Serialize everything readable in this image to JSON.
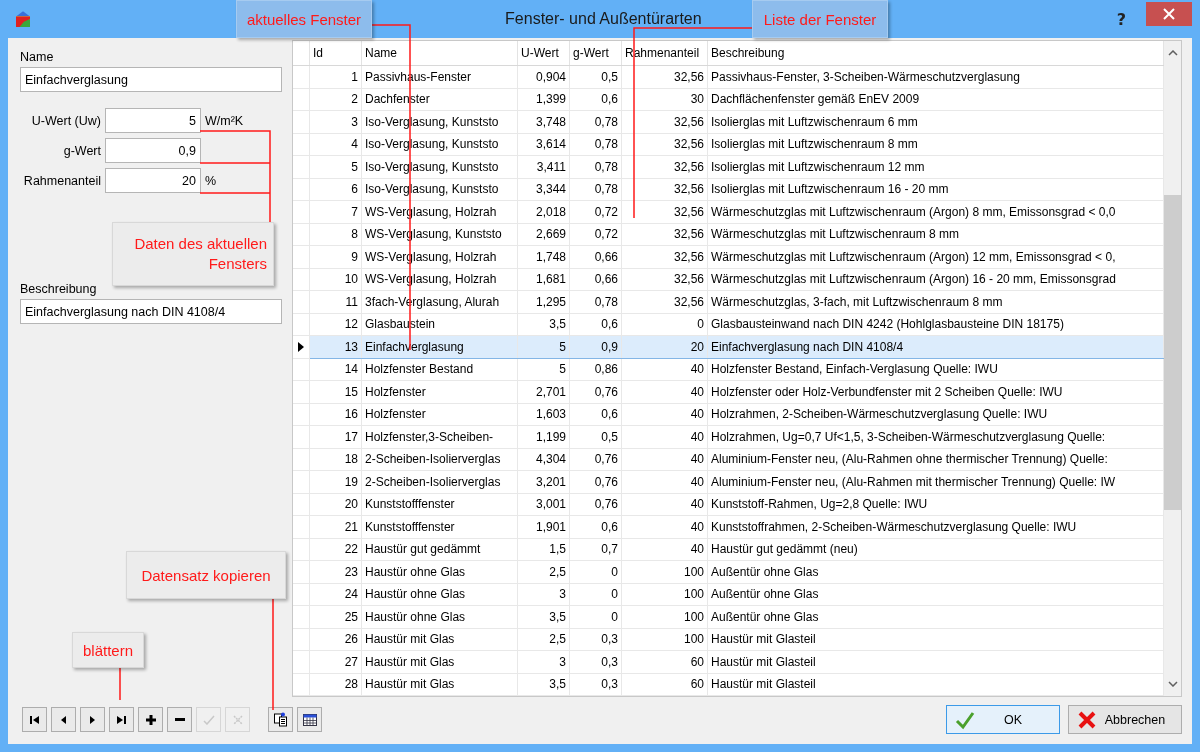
{
  "window": {
    "title": "Fenster- und Außentürarten",
    "help": "?"
  },
  "form": {
    "name_label": "Name",
    "name_value": "Einfachverglasung",
    "fields": [
      {
        "label": "U-Wert (Uw)",
        "value": "5",
        "unit": "W/m²K"
      },
      {
        "label": "g-Wert",
        "value": "0,9"
      },
      {
        "label": "Rahmenanteil",
        "value": "20",
        "unit": "%"
      }
    ],
    "description_label": "Beschreibung",
    "description_value": "Einfachverglasung nach DIN 4108/4"
  },
  "table": {
    "columns": [
      "Id",
      "Name",
      "U-Wert",
      "g-Wert",
      "Rahmenanteil",
      "Beschreibung"
    ],
    "rows": [
      {
        "cells": [
          "1",
          "Passivhaus-Fenster",
          "0,904",
          "0,5",
          "32,56",
          "Passivhaus-Fenster, 3-Scheiben-Wärmeschutzverglasung"
        ],
        "selected": false
      },
      {
        "cells": [
          "2",
          "Dachfenster",
          "1,399",
          "0,6",
          "30",
          "Dachflächenfenster gemäß EnEV 2009"
        ],
        "selected": false
      },
      {
        "cells": [
          "3",
          "Iso-Verglasung, Kunststo",
          "3,748",
          "0,78",
          "32,56",
          "Isolierglas mit Luftzwischenraum 6 mm"
        ],
        "selected": false
      },
      {
        "cells": [
          "4",
          "Iso-Verglasung, Kunststo",
          "3,614",
          "0,78",
          "32,56",
          "Isolierglas mit Luftzwischenraum 8 mm"
        ],
        "selected": false
      },
      {
        "cells": [
          "5",
          "Iso-Verglasung, Kunststo",
          "3,411",
          "0,78",
          "32,56",
          "Isolierglas mit Luftzwischenraum 12 mm"
        ],
        "selected": false
      },
      {
        "cells": [
          "6",
          "Iso-Verglasung, Kunststo",
          "3,344",
          "0,78",
          "32,56",
          "Isolierglas mit Luftzwischenraum 16 - 20 mm"
        ],
        "selected": false
      },
      {
        "cells": [
          "7",
          "WS-Verglasung, Holzrah",
          "2,018",
          "0,72",
          "32,56",
          "Wärmeschutzglas mit Luftzwischenraum (Argon) 8 mm, Emissonsgrad < 0,0"
        ],
        "selected": false
      },
      {
        "cells": [
          "8",
          "WS-Verglasung, Kunststo",
          "2,669",
          "0,72",
          "32,56",
          "Wärmeschutzglas mit Luftzwischenraum 8 mm"
        ],
        "selected": false
      },
      {
        "cells": [
          "9",
          "WS-Verglasung, Holzrah",
          "1,748",
          "0,66",
          "32,56",
          "Wärmeschutzglas mit Luftzwischenraum (Argon) 12 mm, Emissonsgrad < 0,"
        ],
        "selected": false
      },
      {
        "cells": [
          "10",
          "WS-Verglasung, Holzrah",
          "1,681",
          "0,66",
          "32,56",
          "Wärmeschutzglas mit Luftzwischenraum (Argon) 16 - 20 mm, Emissonsgrad"
        ],
        "selected": false
      },
      {
        "cells": [
          "11",
          "3fach-Verglasung, Alurah",
          "1,295",
          "0,78",
          "32,56",
          "Wärmeschutzglas, 3-fach,  mit Luftzwischenraum 8 mm"
        ],
        "selected": false
      },
      {
        "cells": [
          "12",
          "Glasbaustein",
          "3,5",
          "0,6",
          "0",
          "Glasbausteinwand nach DIN 4242 (Hohlglasbausteine DIN 18175)"
        ],
        "selected": false
      },
      {
        "cells": [
          "13",
          "Einfachverglasung",
          "5",
          "0,9",
          "20",
          "Einfachverglasung nach DIN 4108/4"
        ],
        "selected": true
      },
      {
        "cells": [
          "14",
          "Holzfenster Bestand",
          "5",
          "0,86",
          "40",
          "Holzfenster Bestand, Einfach-Verglasung Quelle: IWU"
        ],
        "selected": false
      },
      {
        "cells": [
          "15",
          "Holzfenster",
          "2,701",
          "0,76",
          "40",
          "Holzfenster oder Holz-Verbundfenster mit 2 Scheiben Quelle: IWU"
        ],
        "selected": false
      },
      {
        "cells": [
          "16",
          "Holzfenster",
          "1,603",
          "0,6",
          "40",
          "Holzrahmen, 2-Scheiben-Wärmeschutzverglasung  Quelle: IWU"
        ],
        "selected": false
      },
      {
        "cells": [
          "17",
          "Holzfenster,3-Scheiben-",
          "1,199",
          "0,5",
          "40",
          "Holzrahmen, Ug=0,7 Uf<1,5, 3-Scheiben-Wärmeschutzverglasung Quelle:"
        ],
        "selected": false
      },
      {
        "cells": [
          "18",
          "2-Scheiben-Isolierverglas",
          "4,304",
          "0,76",
          "40",
          "Aluminium-Fenster neu, (Alu-Rahmen ohne thermischer Trennung) Quelle:"
        ],
        "selected": false
      },
      {
        "cells": [
          "19",
          "2-Scheiben-Isolierverglas",
          "3,201",
          "0,76",
          "40",
          "Aluminium-Fenster neu, (Alu-Rahmen mit thermischer Trennung) Quelle: IW"
        ],
        "selected": false
      },
      {
        "cells": [
          "20",
          "Kunststofffenster",
          "3,001",
          "0,76",
          "40",
          "Kunststoff-Rahmen, Ug=2,8 Quelle: IWU"
        ],
        "selected": false
      },
      {
        "cells": [
          "21",
          "Kunststofffenster",
          "1,901",
          "0,6",
          "40",
          "Kunststoffrahmen, 2-Scheiben-Wärmeschutzverglasung  Quelle: IWU"
        ],
        "selected": false
      },
      {
        "cells": [
          "22",
          "Haustür gut gedämmt",
          "1,5",
          "0,7",
          "40",
          "Haustür gut gedämmt (neu)"
        ],
        "selected": false
      },
      {
        "cells": [
          "23",
          "Haustür ohne Glas",
          "2,5",
          "0",
          "100",
          "Außentür ohne Glas"
        ],
        "selected": false
      },
      {
        "cells": [
          "24",
          "Haustür ohne Glas",
          "3",
          "0",
          "100",
          "Außentür ohne Glas"
        ],
        "selected": false
      },
      {
        "cells": [
          "25",
          "Haustür ohne Glas",
          "3,5",
          "0",
          "100",
          "Außentür ohne Glas"
        ],
        "selected": false
      },
      {
        "cells": [
          "26",
          "Haustür mit Glas",
          "2,5",
          "0,3",
          "100",
          "Haustür mit Glasteil"
        ],
        "selected": false
      },
      {
        "cells": [
          "27",
          "Haustür mit Glas",
          "3",
          "0,3",
          "60",
          "Haustür mit Glasteil"
        ],
        "selected": false
      },
      {
        "cells": [
          "28",
          "Haustür mit Glas",
          "3,5",
          "0,3",
          "60",
          "Haustür mit Glasteil"
        ],
        "selected": false
      }
    ]
  },
  "toolbar": [
    {
      "kind": "first",
      "disabled": false
    },
    {
      "kind": "prev",
      "disabled": false
    },
    {
      "kind": "next",
      "disabled": false
    },
    {
      "kind": "last",
      "disabled": false
    },
    {
      "kind": "add",
      "disabled": false
    },
    {
      "kind": "delete",
      "disabled": false
    },
    {
      "kind": "confirm",
      "disabled": true
    },
    {
      "kind": "cancel",
      "disabled": true
    },
    {
      "kind": "copy",
      "disabled": false
    },
    {
      "kind": "grid",
      "disabled": false
    }
  ],
  "buttons": [
    {
      "kind": "ok",
      "label": "OK",
      "focused": true
    },
    {
      "kind": "cancel",
      "label": "Abbrechen",
      "focused": false
    }
  ],
  "annotations": [
    {
      "text": "aktuelles Fenster"
    },
    {
      "text": "Liste der Fenster"
    },
    {
      "text": "Daten des aktuellen Fensters"
    },
    {
      "text": "Datensatz kopieren"
    },
    {
      "text": "blättern"
    }
  ]
}
